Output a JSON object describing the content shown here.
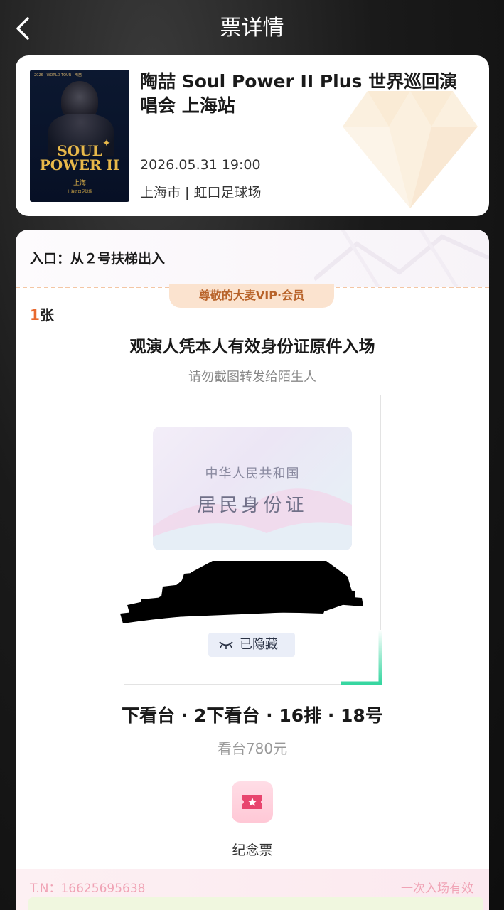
{
  "header": {
    "title": "票详情",
    "back_icon": "chevron-left-icon"
  },
  "event": {
    "name": "陶喆 Soul Power II Plus 世界巡回演唱会 上海站",
    "datetime": "2026.05.31 19:00",
    "venue": "上海市 | 虹口足球场",
    "poster": {
      "top_text": "2026 · WORLD TOUR · 陶喆",
      "title_line1": "SOUL",
      "title_line2": "POWER II",
      "city": "上海",
      "venue_small": "上海虹口足球场"
    }
  },
  "ticket": {
    "entrance": "入口：从２号扶梯出入",
    "vip_badge": "尊敬的大麦VIP·会员",
    "count_number": "1",
    "count_unit": "张",
    "notice": "观演人凭本人有效身份证原件入场",
    "warning": "请勿截图转发给陌生人",
    "id_card": {
      "line1": "中华人民共和国",
      "line2": "居民身份证"
    },
    "hidden_label": "已隐藏",
    "seat": "下看台 · 2下看台 · 16排 · 18号",
    "price": "看台780元",
    "souvenir_label": "纪念票",
    "tn": "T.N：16625695638",
    "validity": "一次入场有效"
  },
  "colors": {
    "accent_orange": "#e8692f",
    "vip_text": "#b8632a",
    "pink_text": "#f0a3b5",
    "souvenir_icon": "#e8456e"
  }
}
